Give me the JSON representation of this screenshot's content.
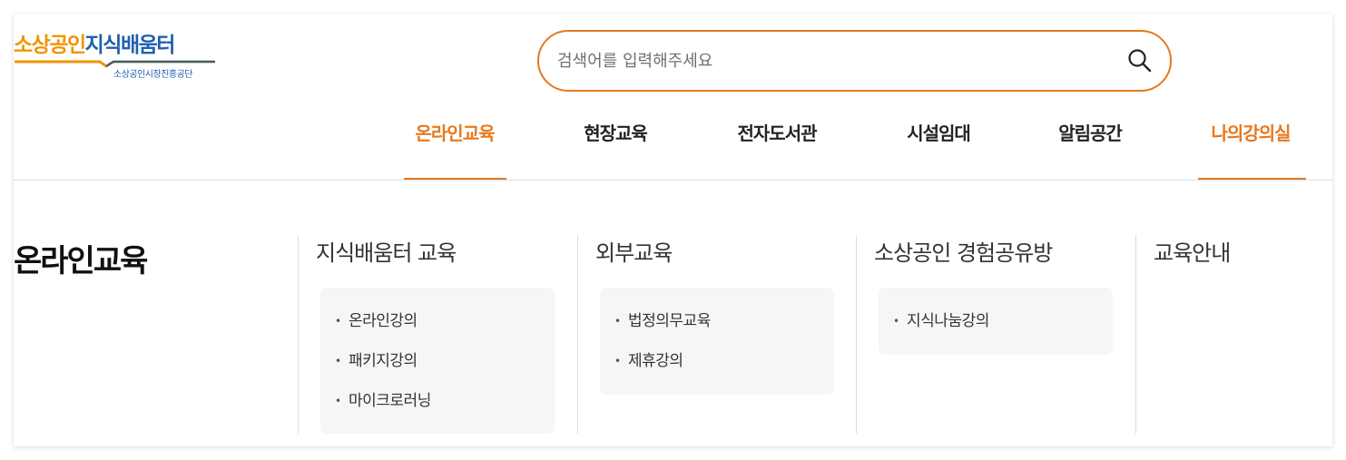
{
  "logo": {
    "part_orange": "소상공인",
    "part_blue": "지식배움터",
    "subtitle": "소상공인시장진흥공단"
  },
  "search": {
    "placeholder": "검색어를 입력해주세요",
    "value": "",
    "icon": "search-icon"
  },
  "gnb": {
    "items": [
      "온라인교육",
      "현장교육",
      "전자도서관",
      "시설임대",
      "알림공간",
      "나의강의실"
    ]
  },
  "mega_menu": {
    "title": "온라인교육",
    "columns": [
      {
        "heading": "지식배움터 교육",
        "items": [
          "온라인강의",
          "패키지강의",
          "마이크로러닝"
        ]
      },
      {
        "heading": "외부교육",
        "items": [
          "법정의무교육",
          "제휴강의"
        ]
      },
      {
        "heading": "소상공인 경험공유방",
        "items": [
          "지식나눔강의"
        ]
      },
      {
        "heading": "교육안내",
        "items": []
      }
    ],
    "bullet": "•"
  },
  "colors": {
    "accent_orange": "#e8781d",
    "logo_orange": "#f29400",
    "logo_blue": "#1f5fb0",
    "text_dark": "#222222",
    "box_bg": "#f6f6f6",
    "divider": "#dddddd"
  }
}
